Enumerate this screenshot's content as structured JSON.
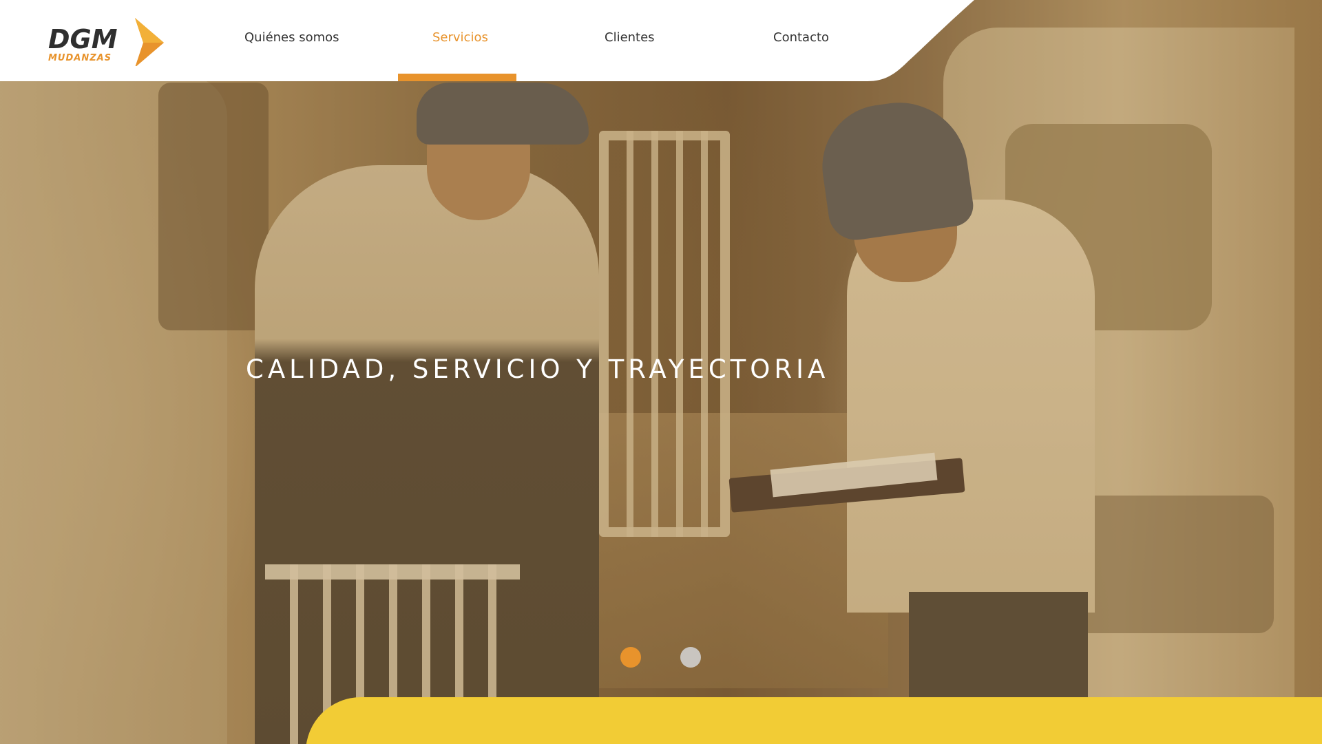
{
  "brand": {
    "logo_text": "DGM",
    "logo_subtext": "MUDANZAS",
    "colors": {
      "accent": "#e8932c",
      "yellow": "#f2cc35",
      "dark": "#2f2f2f",
      "header_bg": "#ffffff",
      "dot_inactive": "#c9c5c0"
    }
  },
  "nav": {
    "items": [
      {
        "label": "Quiénes somos",
        "active": false
      },
      {
        "label": "Servicios",
        "active": true
      },
      {
        "label": "Clientes",
        "active": false
      },
      {
        "label": "Contacto",
        "active": false
      }
    ]
  },
  "hero": {
    "headline": "CALIDAD, SERVICIO Y TRAYECTORIA",
    "slides": {
      "count": 2,
      "current": 1
    }
  }
}
